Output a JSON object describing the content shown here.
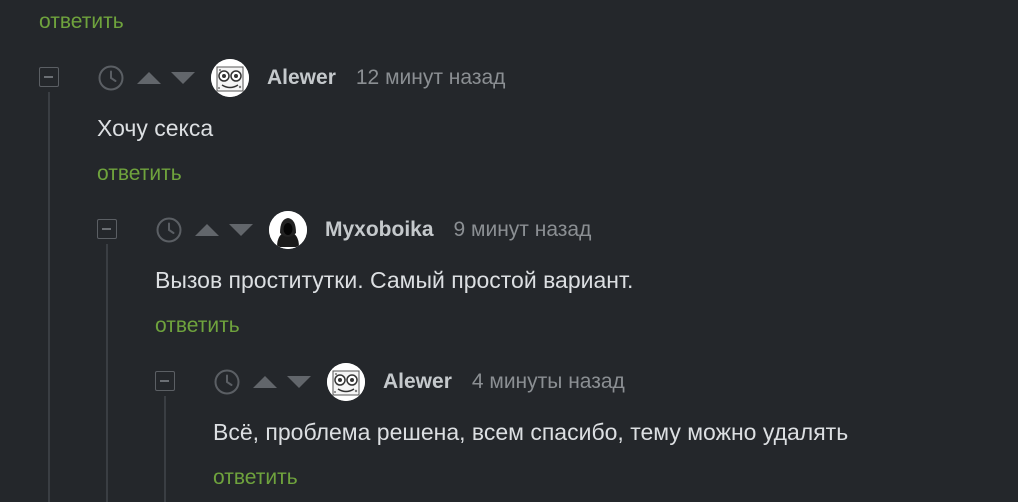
{
  "top_reply_label": "ответить",
  "comments": [
    {
      "username": "Alewer",
      "time": "12 минут назад",
      "text": "Хочу секса",
      "reply_label": "ответить",
      "avatar": "spongebob-avatar"
    },
    {
      "username": "Myxoboika",
      "time": "9 минут назад",
      "text": "Вызов проститутки. Самый простой вариант.",
      "reply_label": "ответить",
      "avatar": "hooded-figure-avatar"
    },
    {
      "username": "Alewer",
      "time": "4 минуты назад",
      "text": "Всё, проблема решена, всем спасибо, тему можно удалять",
      "reply_label": "ответить",
      "avatar": "spongebob-avatar"
    }
  ],
  "colors": {
    "background": "#24272b",
    "reply_link": "#6fa33d",
    "username": "#c5c9cc",
    "timestamp": "#8b8f93",
    "text": "#dcdfe2"
  }
}
